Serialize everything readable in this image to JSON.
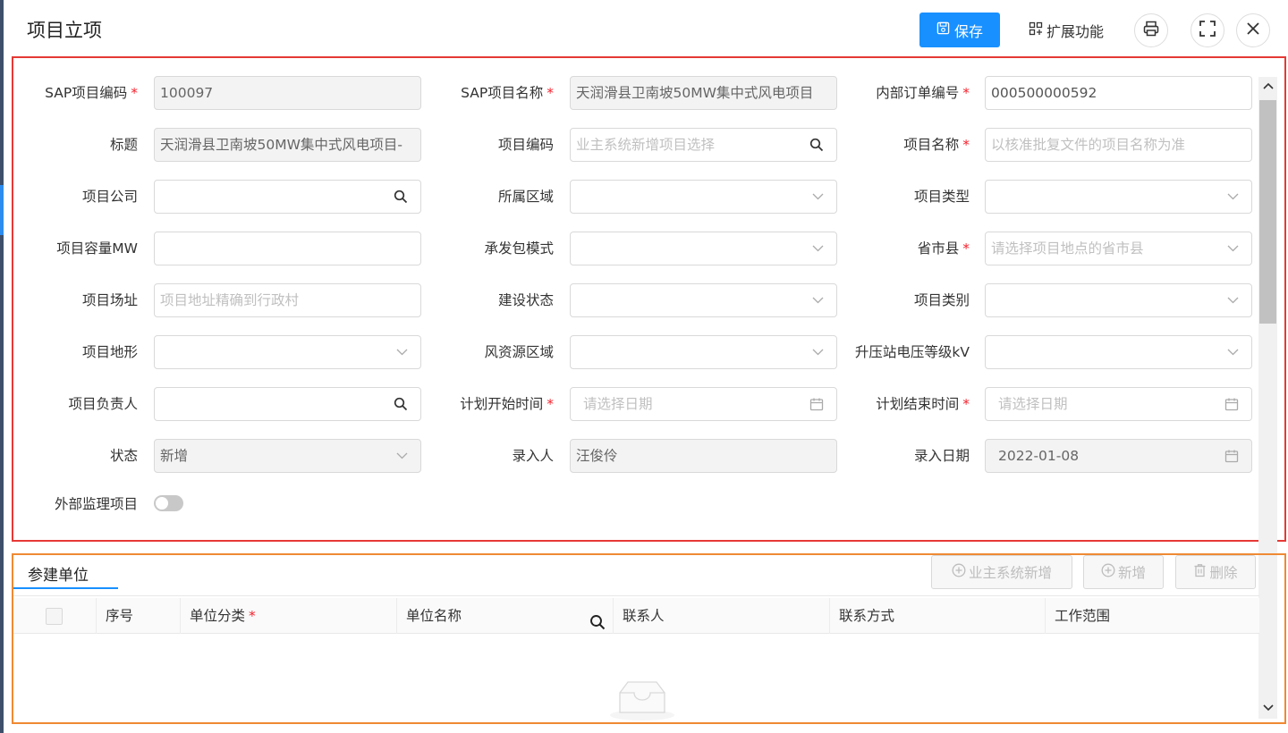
{
  "header": {
    "title": "项目立项",
    "save_label": "保存",
    "extend_label": "扩展功能",
    "icons": [
      "save-icon",
      "extend-icon",
      "print-icon",
      "fullscreen-icon",
      "close-icon"
    ]
  },
  "form": {
    "fields": [
      {
        "label": "SAP项目编码",
        "required": "*",
        "value": "100097",
        "placeholder": "",
        "kind": "text",
        "disabled": true
      },
      {
        "label": "SAP项目名称",
        "required": "*",
        "value": "天润滑县卫南坡50MW集中式风电项目",
        "placeholder": "",
        "kind": "text",
        "disabled": true
      },
      {
        "label": "内部订单编号",
        "required": "*",
        "value": "000500000592",
        "placeholder": "",
        "kind": "text",
        "disabled": false
      },
      {
        "label": "标题",
        "required": "",
        "value": "天润滑县卫南坡50MW集中式风电项目-",
        "placeholder": "",
        "kind": "text",
        "disabled": true
      },
      {
        "label": "项目编码",
        "required": "",
        "value": "",
        "placeholder": "业主系统新增项目选择",
        "kind": "search",
        "disabled": false
      },
      {
        "label": "项目名称",
        "required": "*",
        "value": "",
        "placeholder": "以核准批复文件的项目名称为准",
        "kind": "text",
        "disabled": false
      },
      {
        "label": "项目公司",
        "required": "",
        "value": "",
        "placeholder": "",
        "kind": "search",
        "disabled": false
      },
      {
        "label": "所属区域",
        "required": "",
        "value": "",
        "placeholder": "",
        "kind": "select",
        "disabled": false
      },
      {
        "label": "项目类型",
        "required": "",
        "value": "",
        "placeholder": "",
        "kind": "select",
        "disabled": false
      },
      {
        "label": "项目容量MW",
        "required": "",
        "value": "",
        "placeholder": "",
        "kind": "text",
        "disabled": false
      },
      {
        "label": "承发包模式",
        "required": "",
        "value": "",
        "placeholder": "",
        "kind": "select",
        "disabled": false
      },
      {
        "label": "省市县",
        "required": "*",
        "value": "",
        "placeholder": "请选择项目地点的省市县",
        "kind": "select",
        "disabled": false
      },
      {
        "label": "项目场址",
        "required": "",
        "value": "",
        "placeholder": "项目地址精确到行政村",
        "kind": "text",
        "disabled": false
      },
      {
        "label": "建设状态",
        "required": "",
        "value": "",
        "placeholder": "",
        "kind": "select",
        "disabled": false
      },
      {
        "label": "项目类别",
        "required": "",
        "value": "",
        "placeholder": "",
        "kind": "select",
        "disabled": false
      },
      {
        "label": "项目地形",
        "required": "",
        "value": "",
        "placeholder": "",
        "kind": "select",
        "disabled": false
      },
      {
        "label": "风资源区域",
        "required": "",
        "value": "",
        "placeholder": "",
        "kind": "select",
        "disabled": false
      },
      {
        "label": "升压站电压等级kV",
        "required": "",
        "value": "",
        "placeholder": "",
        "kind": "select",
        "disabled": false
      },
      {
        "label": "项目负责人",
        "required": "",
        "value": "",
        "placeholder": "",
        "kind": "search",
        "disabled": false
      },
      {
        "label": "计划开始时间",
        "required": "*",
        "value": "",
        "placeholder": "请选择日期",
        "kind": "date",
        "disabled": false
      },
      {
        "label": "计划结束时间",
        "required": "*",
        "value": "",
        "placeholder": "请选择日期",
        "kind": "date",
        "disabled": false
      },
      {
        "label": "状态",
        "required": "",
        "value": "新增",
        "placeholder": "",
        "kind": "select",
        "disabled": true
      },
      {
        "label": "录入人",
        "required": "",
        "value": "汪俊伶",
        "placeholder": "",
        "kind": "text",
        "disabled": true
      },
      {
        "label": "录入日期",
        "required": "",
        "value": "2022-01-08",
        "placeholder": "",
        "kind": "date",
        "disabled": true
      }
    ],
    "external_supervision": {
      "label": "外部监理项目",
      "checked": false
    }
  },
  "participants": {
    "tab_label": "参建单位",
    "buttons": {
      "owner_add": "业主系统新增",
      "add": "新增",
      "delete": "删除"
    },
    "columns": [
      "序号",
      "单位分类",
      "单位名称",
      "联系人",
      "联系方式",
      "工作范围"
    ],
    "required_mark": "*",
    "rows": []
  },
  "colors": {
    "primary": "#1890ff",
    "required": "#f5222d",
    "form_highlight": "#e53935",
    "table_highlight": "#ef8a33"
  }
}
